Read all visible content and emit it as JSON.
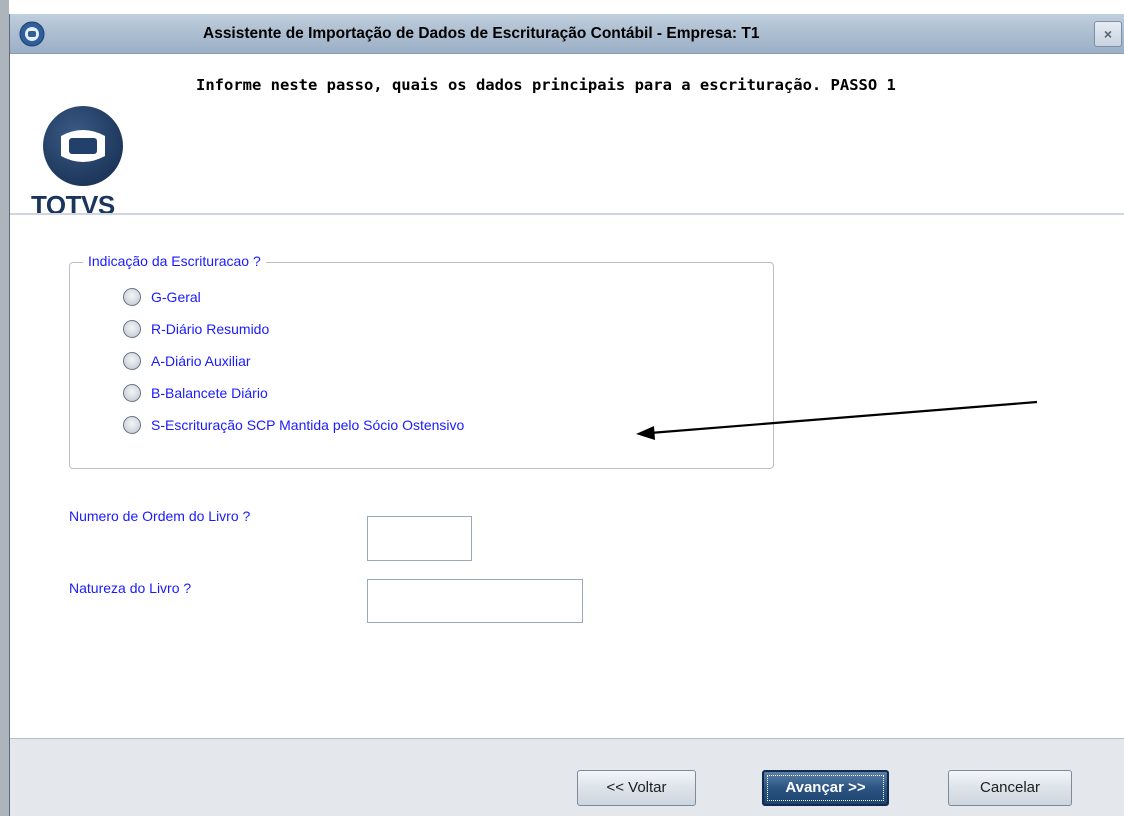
{
  "window": {
    "title": "Assistente de Importação de Dados de Escrituração Contábil - Empresa: T1",
    "close_label": "×",
    "app_icon": "circle-app-icon"
  },
  "header": {
    "logo_text": "TOTVS",
    "instruction": "Informe neste passo, quais os dados principais para a escrituração. PASSO 1"
  },
  "indicacao": {
    "legend": "Indicação da Escrituracao ?",
    "options": [
      {
        "label": "G-Geral",
        "selected": false
      },
      {
        "label": "R-Diário Resumido",
        "selected": false
      },
      {
        "label": "A-Diário Auxiliar",
        "selected": false
      },
      {
        "label": "B-Balancete Diário",
        "selected": false
      },
      {
        "label": "S-Escrituração SCP Mantida pelo Sócio Ostensivo",
        "selected": false
      }
    ]
  },
  "fields": {
    "numero_ordem": {
      "label": "Numero de Ordem do Livro ?",
      "value": ""
    },
    "natureza": {
      "label": "Natureza do Livro  ?",
      "value": ""
    }
  },
  "annotation": {
    "arrow_color": "#000000",
    "points_to": "S-Escrituração SCP Mantida pelo Sócio Ostensivo"
  },
  "footer": {
    "back_label": "<< Voltar",
    "next_label": "Avançar >>",
    "cancel_label": "Cancelar"
  },
  "colors": {
    "label_blue": "#1a1aff",
    "primary_button": "#2b5482",
    "footer_bg": "#e4e8ed"
  }
}
